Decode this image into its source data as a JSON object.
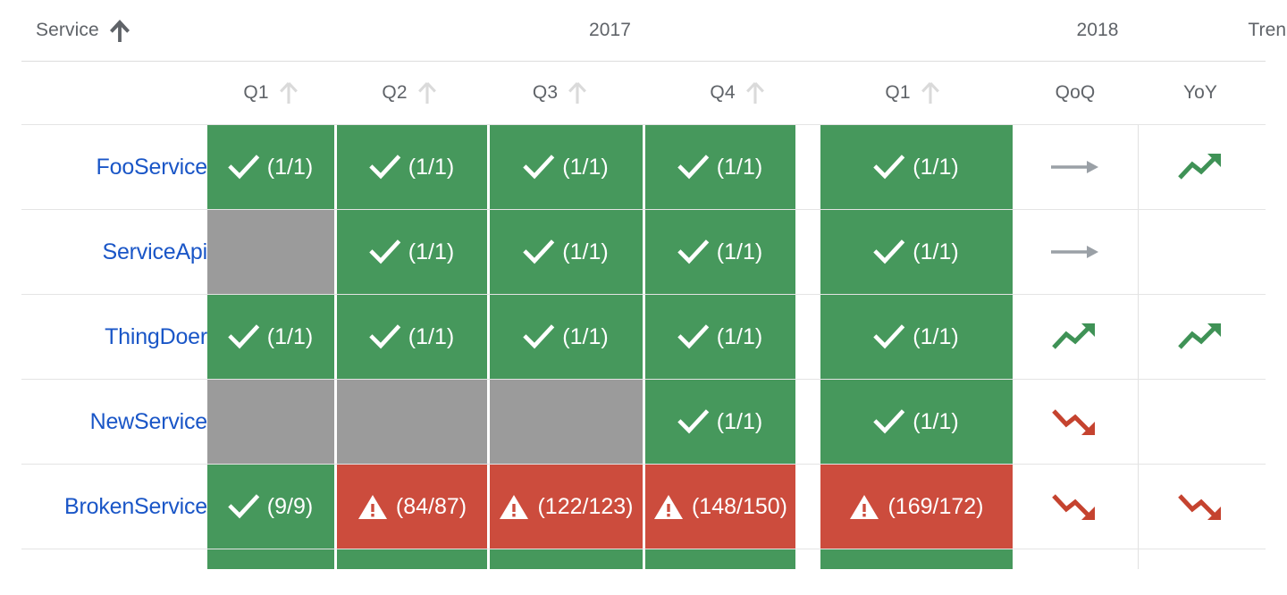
{
  "table": {
    "group_headers": [
      {
        "label": "Service",
        "sort_icon": "sort-arrow-up-active-icon",
        "sorted": true
      },
      {
        "label": "2017",
        "sort_icon": null,
        "sorted": false
      },
      {
        "label": "2018",
        "sort_icon": null,
        "sorted": false
      },
      {
        "label": "Trends",
        "sort_icon": null,
        "sorted": false
      }
    ],
    "columns": [
      {
        "key": "service",
        "label": "",
        "sort_icon": null
      },
      {
        "key": "2017q1",
        "label": "Q1",
        "sort_icon": "sort-arrow-up-inactive-icon"
      },
      {
        "key": "2017q2",
        "label": "Q2",
        "sort_icon": "sort-arrow-up-inactive-icon"
      },
      {
        "key": "2017q3",
        "label": "Q3",
        "sort_icon": "sort-arrow-up-inactive-icon"
      },
      {
        "key": "2017q4",
        "label": "Q4",
        "sort_icon": "sort-arrow-up-inactive-icon"
      },
      {
        "key": "2018q1",
        "label": "Q1",
        "sort_icon": "sort-arrow-up-inactive-icon"
      },
      {
        "key": "qoq",
        "label": "QoQ",
        "sort_icon": null
      },
      {
        "key": "yoy",
        "label": "YoY",
        "sort_icon": null
      }
    ],
    "rows": [
      {
        "service": "FooService",
        "cells": [
          {
            "state": "pass",
            "icon": "check-icon",
            "ratio": "(1/1)"
          },
          {
            "state": "pass",
            "icon": "check-icon",
            "ratio": "(1/1)"
          },
          {
            "state": "pass",
            "icon": "check-icon",
            "ratio": "(1/1)"
          },
          {
            "state": "pass",
            "icon": "check-icon",
            "ratio": "(1/1)"
          },
          {
            "state": "pass",
            "icon": "check-icon",
            "ratio": "(1/1)"
          }
        ],
        "qoq": {
          "trend": "flat",
          "icon": "trend-flat-icon"
        },
        "yoy": {
          "trend": "up",
          "icon": "trend-up-icon"
        }
      },
      {
        "service": "ServiceApi",
        "cells": [
          {
            "state": "none",
            "icon": null,
            "ratio": ""
          },
          {
            "state": "pass",
            "icon": "check-icon",
            "ratio": "(1/1)"
          },
          {
            "state": "pass",
            "icon": "check-icon",
            "ratio": "(1/1)"
          },
          {
            "state": "pass",
            "icon": "check-icon",
            "ratio": "(1/1)"
          },
          {
            "state": "pass",
            "icon": "check-icon",
            "ratio": "(1/1)"
          }
        ],
        "qoq": {
          "trend": "flat",
          "icon": "trend-flat-icon"
        },
        "yoy": {
          "trend": "none",
          "icon": null
        }
      },
      {
        "service": "ThingDoer",
        "cells": [
          {
            "state": "pass",
            "icon": "check-icon",
            "ratio": "(1/1)"
          },
          {
            "state": "pass",
            "icon": "check-icon",
            "ratio": "(1/1)"
          },
          {
            "state": "pass",
            "icon": "check-icon",
            "ratio": "(1/1)"
          },
          {
            "state": "pass",
            "icon": "check-icon",
            "ratio": "(1/1)"
          },
          {
            "state": "pass",
            "icon": "check-icon",
            "ratio": "(1/1)"
          }
        ],
        "qoq": {
          "trend": "up",
          "icon": "trend-up-icon"
        },
        "yoy": {
          "trend": "up",
          "icon": "trend-up-icon"
        }
      },
      {
        "service": "NewService",
        "cells": [
          {
            "state": "none",
            "icon": null,
            "ratio": ""
          },
          {
            "state": "none",
            "icon": null,
            "ratio": ""
          },
          {
            "state": "none",
            "icon": null,
            "ratio": ""
          },
          {
            "state": "pass",
            "icon": "check-icon",
            "ratio": "(1/1)"
          },
          {
            "state": "pass",
            "icon": "check-icon",
            "ratio": "(1/1)"
          }
        ],
        "qoq": {
          "trend": "down",
          "icon": "trend-down-icon"
        },
        "yoy": {
          "trend": "none",
          "icon": null
        }
      },
      {
        "service": "BrokenService",
        "cells": [
          {
            "state": "pass",
            "icon": "check-icon",
            "ratio": "(9/9)"
          },
          {
            "state": "fail",
            "icon": "warning-icon",
            "ratio": "(84/87)"
          },
          {
            "state": "fail",
            "icon": "warning-icon",
            "ratio": "(122/123)"
          },
          {
            "state": "fail",
            "icon": "warning-icon",
            "ratio": "(148/150)"
          },
          {
            "state": "fail",
            "icon": "warning-icon",
            "ratio": "(169/172)"
          }
        ],
        "qoq": {
          "trend": "down",
          "icon": "trend-down-icon"
        },
        "yoy": {
          "trend": "down",
          "icon": "trend-down-icon"
        }
      },
      {
        "service": "",
        "clipped": true,
        "cells": [
          {
            "state": "pass",
            "icon": null,
            "ratio": ""
          },
          {
            "state": "pass",
            "icon": null,
            "ratio": ""
          },
          {
            "state": "pass",
            "icon": null,
            "ratio": ""
          },
          {
            "state": "pass",
            "icon": null,
            "ratio": ""
          },
          {
            "state": "pass",
            "icon": null,
            "ratio": ""
          }
        ],
        "qoq": {
          "trend": "none",
          "icon": null
        },
        "yoy": {
          "trend": "none",
          "icon": null
        }
      }
    ]
  },
  "colors": {
    "pass": "#46985c",
    "fail": "#cc4c3d",
    "none": "#9b9b9b",
    "link": "#1a56c7",
    "header_text": "#5f6368",
    "trend_up": "#3f9256",
    "trend_down": "#c5432f",
    "trend_flat": "#9aa0a6",
    "sort_active": "#5f6368",
    "sort_inactive": "#dadada",
    "divider": "#e4e4e4"
  }
}
